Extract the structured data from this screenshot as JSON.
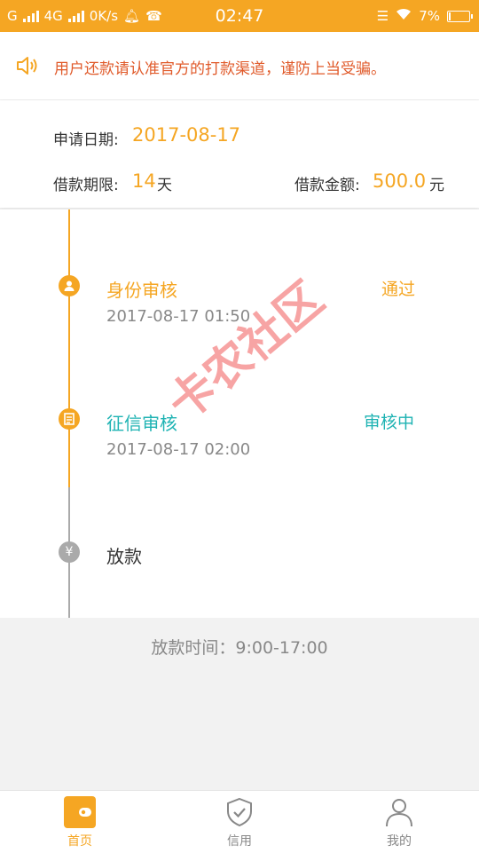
{
  "status_bar": {
    "carrier1": "G",
    "carrier2": "4G",
    "speed": "0K/s",
    "time": "02:47",
    "battery": "7%"
  },
  "notice": {
    "text": "用户还款请认准官方的打款渠道，谨防上当受骗。"
  },
  "application": {
    "date_label": "申请日期:",
    "date_value": "2017-08-17",
    "term_label": "借款期限:",
    "term_value": "14",
    "term_unit": "天",
    "amount_label": "借款金额:",
    "amount_value": "500.0",
    "amount_unit": "元"
  },
  "steps": [
    {
      "title": "身份审核",
      "time": "2017-08-17 01:50",
      "status": "通过",
      "icon": "user-icon"
    },
    {
      "title": "征信审核",
      "time": "2017-08-17 02:00",
      "status": "审核中",
      "icon": "document-icon"
    },
    {
      "title": "放款",
      "icon": "yen-icon"
    }
  ],
  "disburse_time": "放款时间：9:00-17:00",
  "watermark": "卡农社区",
  "bottom_nav": [
    {
      "label": "首页",
      "icon": "wallet-icon",
      "active": true
    },
    {
      "label": "信用",
      "icon": "shield-check-icon",
      "active": false
    },
    {
      "label": "我的",
      "icon": "person-icon",
      "active": false
    }
  ],
  "colors": {
    "accent": "#f5a623",
    "teal": "#1fb3b3",
    "warning": "#e05a2a",
    "inactive": "#888888"
  }
}
